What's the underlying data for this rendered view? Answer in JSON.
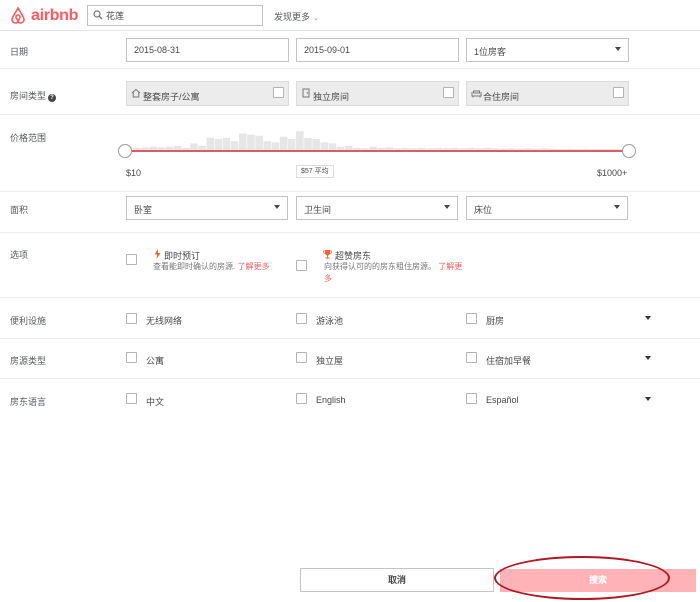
{
  "header": {
    "logo_text": "airbnb",
    "search_value": "花莲",
    "discover_label": "发现更多"
  },
  "dates": {
    "label": "日期",
    "checkin": "2015-08-31",
    "checkout": "2015-09-01",
    "guests": "1位房客"
  },
  "room_type": {
    "label": "房间类型",
    "help_icon": "?",
    "options": [
      {
        "label": "整套房子/公寓",
        "icon": "house-icon",
        "checked": false
      },
      {
        "label": "独立房间",
        "icon": "door-icon",
        "checked": false
      },
      {
        "label": "合住房间",
        "icon": "couch-icon",
        "checked": false
      }
    ]
  },
  "price": {
    "label": "价格范围",
    "min_label": "$10",
    "max_label": "$1000+",
    "average_label": "$57 平均",
    "histogram": [
      0.15,
      0.1,
      0.12,
      0.15,
      0.12,
      0.15,
      0.18,
      0.1,
      0.3,
      0.2,
      0.55,
      0.5,
      0.55,
      0.4,
      0.75,
      0.7,
      0.65,
      0.4,
      0.35,
      0.6,
      0.5,
      0.85,
      0.55,
      0.5,
      0.35,
      0.3,
      0.15,
      0.2,
      0.1,
      0.08,
      0.15,
      0.1,
      0.12,
      0.08,
      0.1,
      0.08,
      0.1,
      0.08,
      0.1,
      0.08,
      0.1,
      0.08,
      0.1,
      0.08,
      0.1,
      0.08,
      0.06,
      0.08,
      0.06,
      0.08,
      0.06,
      0.08,
      0.06,
      0.05,
      0.06,
      0.05,
      0.06,
      0.05,
      0.05,
      0.05,
      0.05,
      0.05
    ]
  },
  "size": {
    "label": "面积",
    "bedrooms": "卧室",
    "bathrooms": "卫生间",
    "beds": "床位"
  },
  "options": {
    "label": "选项",
    "instant_book": {
      "title": "即时预订",
      "desc": "查看能即时确认的房源.",
      "link": "了解更多",
      "checked": false
    },
    "superhost": {
      "title": "超赞房东",
      "desc_line1": "向获得认可的的房东租住房源。",
      "link_part1": "了解更",
      "link_part2": "多",
      "checked": false
    }
  },
  "amenities": {
    "label": "便利设施",
    "items": [
      "无线网络",
      "游泳池",
      "厨房"
    ]
  },
  "property_type": {
    "label": "房源类型",
    "items": [
      "公寓",
      "独立屋",
      "住宿加早餐"
    ]
  },
  "host_language": {
    "label": "房东语言",
    "items": [
      "中文",
      "English",
      "Español"
    ]
  },
  "footer": {
    "cancel_label": "取消",
    "search_label": "搜索"
  },
  "colors": {
    "brand": "#ff5a5f",
    "search_button": "#ffb3b6",
    "annotation": "#b0171f",
    "track": "#e05a5f"
  }
}
